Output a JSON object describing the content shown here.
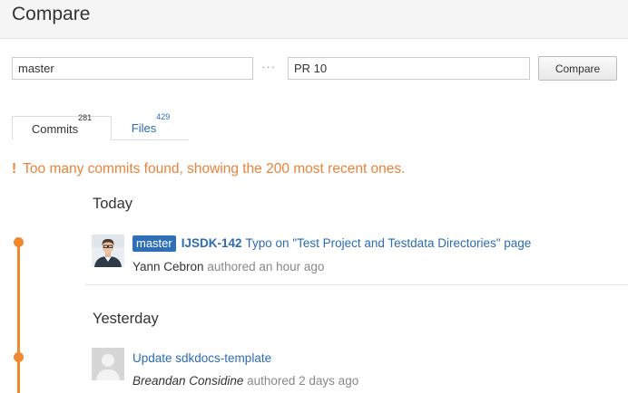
{
  "header": {
    "title": "Compare"
  },
  "compare": {
    "base_ref": "master",
    "dots": "···",
    "head_ref": "PR 10",
    "button_label": "Compare"
  },
  "tabs": [
    {
      "label": "Commits",
      "count": "281",
      "active": true
    },
    {
      "label": "Files",
      "count": "429",
      "active": false
    }
  ],
  "warning": {
    "icon": "!",
    "text": "Too many commits found, showing the 200 most recent ones."
  },
  "colors": {
    "accent": "#f0892e",
    "link": "#2b6bb2",
    "badge": "#2f6fb7",
    "warning": "#e8833a"
  },
  "days": [
    {
      "label": "Today",
      "commits": [
        {
          "avatar_icon": "user-photo-icon",
          "branch": "master",
          "issue_key": "IJSDK-142",
          "message": "Typo on \"Test Project and Testdata Directories\" page",
          "author": "Yann Cebron",
          "authored_text": "authored an hour ago"
        }
      ]
    },
    {
      "label": "Yesterday",
      "commits": [
        {
          "avatar_icon": "default-avatar-icon",
          "message": "Update sdkdocs-template",
          "author": "Breandan Considine",
          "authored_text": "authored 2 days ago"
        }
      ]
    }
  ]
}
